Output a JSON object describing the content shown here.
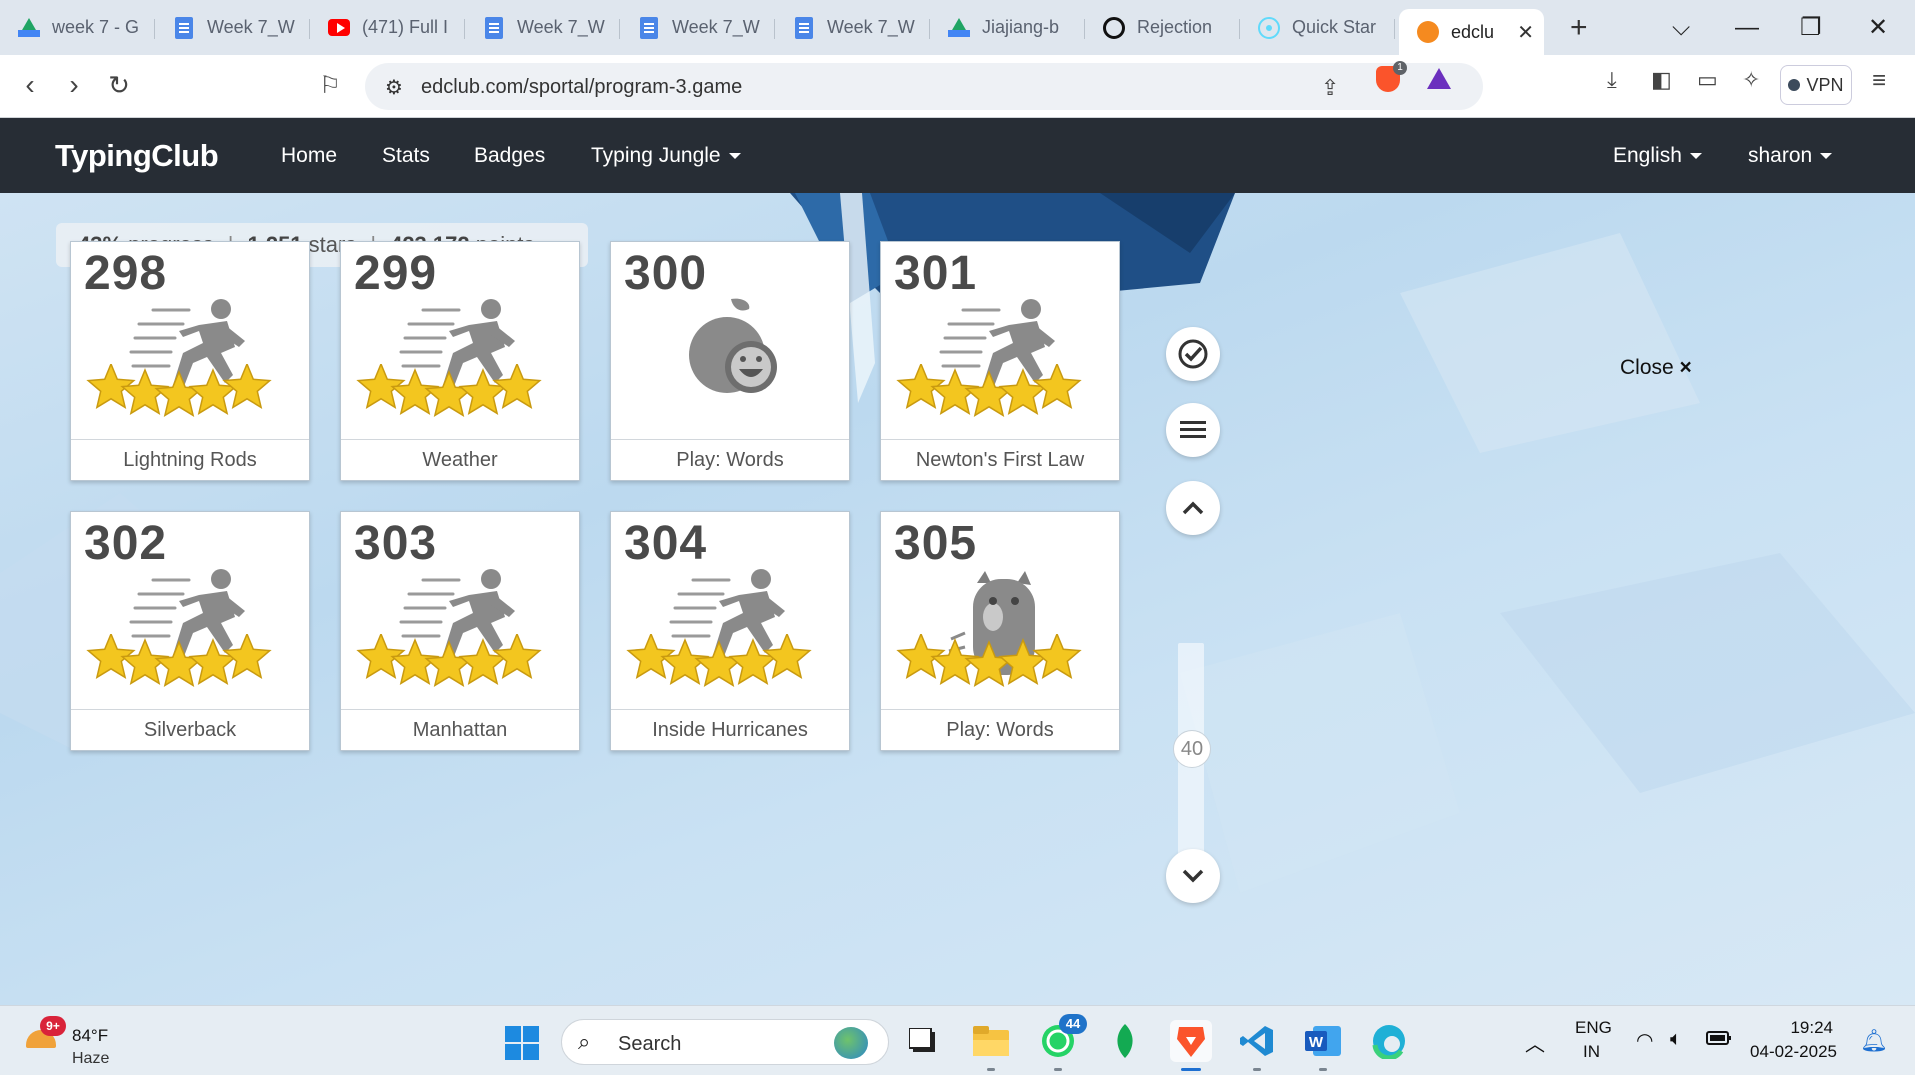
{
  "browser": {
    "tabs": [
      {
        "label": "week 7 - G",
        "icon": "google-drive-icon"
      },
      {
        "label": "Week 7_W",
        "icon": "google-docs-icon"
      },
      {
        "label": "(471) Full I",
        "icon": "youtube-icon"
      },
      {
        "label": "Week 7_W",
        "icon": "google-docs-icon"
      },
      {
        "label": "Week 7_W",
        "icon": "google-docs-icon"
      },
      {
        "label": "Week 7_W",
        "icon": "google-docs-icon"
      },
      {
        "label": "Jiajiang-b",
        "icon": "google-drive-icon"
      },
      {
        "label": "Rejection",
        "icon": "openai-icon"
      },
      {
        "label": "Quick Star",
        "icon": "react-icon"
      }
    ],
    "active_tab": {
      "label": "edclu",
      "icon": "edclub-icon"
    },
    "new_tab": "+",
    "url": "edclub.com/sportal/program-3.game",
    "brave_badge": "1",
    "vpn_label": "VPN"
  },
  "site": {
    "logo": "TypingClub",
    "nav": {
      "home": "Home",
      "stats": "Stats",
      "badges": "Badges",
      "jungle": "Typing Jungle",
      "language": "English",
      "user": "sharon"
    }
  },
  "stats": {
    "progress_value": "43%",
    "progress_label": "progress",
    "stars_value": "1,251",
    "stars_label": "stars",
    "points_value": "423,172",
    "points_label": "points"
  },
  "lessons": [
    {
      "number": "298",
      "title": "Lightning Rods",
      "kind": "runner",
      "stars": 5
    },
    {
      "number": "299",
      "title": "Weather",
      "kind": "runner",
      "stars": 5
    },
    {
      "number": "300",
      "title": "Play: Words",
      "kind": "game-apple",
      "stars": 0
    },
    {
      "number": "301",
      "title": "Newton's First Law",
      "kind": "runner",
      "stars": 5
    },
    {
      "number": "302",
      "title": "Silverback",
      "kind": "runner",
      "stars": 5
    },
    {
      "number": "303",
      "title": "Manhattan",
      "kind": "runner",
      "stars": 5
    },
    {
      "number": "304",
      "title": "Inside Hurricanes",
      "kind": "runner",
      "stars": 5
    },
    {
      "number": "305",
      "title": "Play: Words",
      "kind": "game-monster",
      "stars": 5
    }
  ],
  "side": {
    "slider_value": "40",
    "close_label": "Close",
    "close_icon": "×"
  },
  "taskbar": {
    "weather_badge": "9+",
    "temperature": "84°F",
    "condition": "Haze",
    "search_label": "Search",
    "whatsapp_badge": "44",
    "lang_top": "ENG",
    "lang_bottom": "IN",
    "time": "19:24",
    "date": "04-02-2025"
  },
  "colors": {
    "nav_bg": "#272d35",
    "star": "#f3c61f",
    "accent_blue": "#1d6fd1"
  }
}
